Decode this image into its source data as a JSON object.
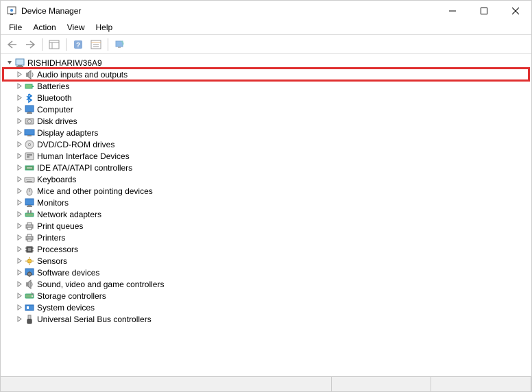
{
  "window": {
    "title": "Device Manager"
  },
  "menu": {
    "file": "File",
    "action": "Action",
    "view": "View",
    "help": "Help"
  },
  "tree": {
    "root": "RISHIDHARIW36A9",
    "items": [
      {
        "label": "Audio inputs and outputs",
        "icon": "speaker",
        "highlight": true
      },
      {
        "label": "Batteries",
        "icon": "battery"
      },
      {
        "label": "Bluetooth",
        "icon": "bluetooth"
      },
      {
        "label": "Computer",
        "icon": "monitor"
      },
      {
        "label": "Disk drives",
        "icon": "disk"
      },
      {
        "label": "Display adapters",
        "icon": "display"
      },
      {
        "label": "DVD/CD-ROM drives",
        "icon": "cd"
      },
      {
        "label": "Human Interface Devices",
        "icon": "hid"
      },
      {
        "label": "IDE ATA/ATAPI controllers",
        "icon": "ide"
      },
      {
        "label": "Keyboards",
        "icon": "keyboard"
      },
      {
        "label": "Mice and other pointing devices",
        "icon": "mouse"
      },
      {
        "label": "Monitors",
        "icon": "monitor"
      },
      {
        "label": "Network adapters",
        "icon": "network"
      },
      {
        "label": "Print queues",
        "icon": "printer"
      },
      {
        "label": "Printers",
        "icon": "printer"
      },
      {
        "label": "Processors",
        "icon": "cpu"
      },
      {
        "label": "Sensors",
        "icon": "sensor"
      },
      {
        "label": "Software devices",
        "icon": "software"
      },
      {
        "label": "Sound, video and game controllers",
        "icon": "sound"
      },
      {
        "label": "Storage controllers",
        "icon": "storage"
      },
      {
        "label": "System devices",
        "icon": "system"
      },
      {
        "label": "Universal Serial Bus controllers",
        "icon": "usb"
      }
    ]
  }
}
